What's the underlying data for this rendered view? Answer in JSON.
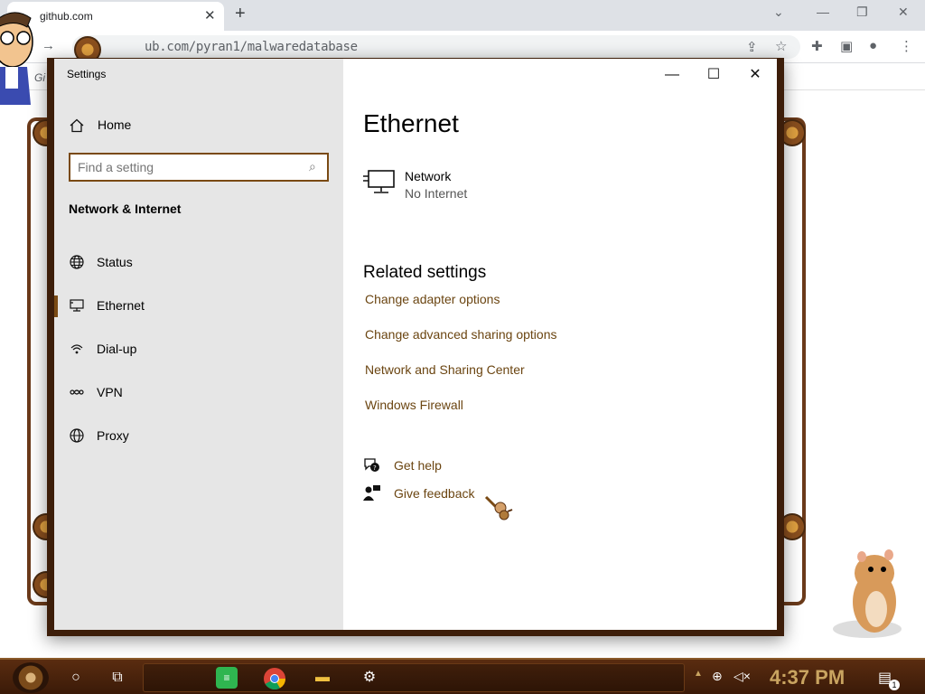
{
  "browser": {
    "tab_title": "github.com",
    "tab_close": "✕",
    "new_tab": "+",
    "url": "ub.com/pyran1/malwaredatabase",
    "bookmark": "Gi",
    "controls": {
      "minimize": "—",
      "restore": "❐",
      "close": "✕",
      "tab_search": "⌄"
    }
  },
  "settings": {
    "window_title": "Settings",
    "home_label": "Home",
    "search_placeholder": "Find a setting",
    "section_title": "Network & Internet",
    "nav_items": [
      {
        "label": "Status",
        "icon": "globe-status-icon"
      },
      {
        "label": "Ethernet",
        "icon": "ethernet-icon",
        "active": true
      },
      {
        "label": "Dial-up",
        "icon": "dialup-icon"
      },
      {
        "label": "VPN",
        "icon": "vpn-icon"
      },
      {
        "label": "Proxy",
        "icon": "globe-icon"
      }
    ],
    "page_title": "Ethernet",
    "network": {
      "name": "Network",
      "status": "No Internet"
    },
    "related_title": "Related settings",
    "related_links": [
      "Change adapter options",
      "Change advanced sharing options",
      "Network and Sharing Center",
      "Windows Firewall"
    ],
    "help": {
      "get_help": "Get help",
      "give_feedback": "Give feedback"
    }
  },
  "taskbar": {
    "clock": "4:37 PM",
    "notification_count": "1"
  },
  "colors": {
    "accent": "#7a4a14",
    "link": "#6b4511",
    "frame": "#3d1e0a",
    "clock": "#c9a460"
  }
}
